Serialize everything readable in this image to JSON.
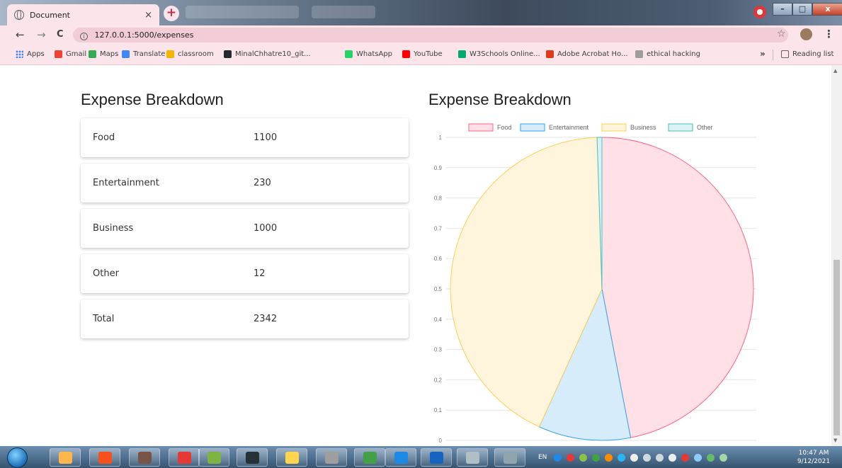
{
  "browser": {
    "tab_title": "Document",
    "tab_close": "×",
    "new_tab": "+",
    "url": "127.0.0.1:5000/expenses",
    "nav": {
      "back": "←",
      "forward": "→",
      "reload": "C"
    },
    "bookmarks": [
      {
        "label": "Apps",
        "color": "#4285f4"
      },
      {
        "label": "Gmail",
        "color": "#ea4335"
      },
      {
        "label": "Maps",
        "color": "#34a853"
      },
      {
        "label": "Translate",
        "color": "#4285f4"
      },
      {
        "label": "classroom",
        "color": "#f4b400"
      },
      {
        "label": "MinalChhatre10_git...",
        "color": "#24292e"
      },
      {
        "label": "WhatsApp",
        "color": "#25d366"
      },
      {
        "label": "YouTube",
        "color": "#ff0000"
      },
      {
        "label": "W3Schools Online...",
        "color": "#04aa6d"
      },
      {
        "label": "Adobe Acrobat Ho...",
        "color": "#e03a1e"
      },
      {
        "label": "ethical hacking",
        "color": "#9e9e9e"
      }
    ],
    "bookmarks_more": "»",
    "reading_list": "Reading list"
  },
  "page": {
    "table_heading": "Expense Breakdown",
    "chart_heading": "Expense Breakdown",
    "rows": [
      {
        "label": "Food",
        "value": "1100"
      },
      {
        "label": "Entertainment",
        "value": "230"
      },
      {
        "label": "Business",
        "value": "1000"
      },
      {
        "label": "Other",
        "value": "12"
      },
      {
        "label": "Total",
        "value": "2342"
      }
    ]
  },
  "chart_data": {
    "type": "pie",
    "categories": [
      "Food",
      "Entertainment",
      "Business",
      "Other"
    ],
    "values": [
      1100,
      230,
      1000,
      12
    ],
    "colors": {
      "fill": [
        "#ffe0e6",
        "#d7ecfb",
        "#fff5dd",
        "#dbf2f2"
      ],
      "stroke": [
        "#ff6384",
        "#36a2eb",
        "#ffcd56",
        "#4bc0c0"
      ]
    },
    "legend_position": "top",
    "y_ticks": [
      "0",
      "0.1",
      "0.2",
      "0.3",
      "0.4",
      "0.5",
      "0.6",
      "0.7",
      "0.8",
      "0.9",
      "1"
    ],
    "ylim": [
      0,
      1
    ],
    "grid": true
  },
  "taskbar": {
    "language": "EN",
    "time": "10:47 AM",
    "date": "9/12/2021"
  }
}
